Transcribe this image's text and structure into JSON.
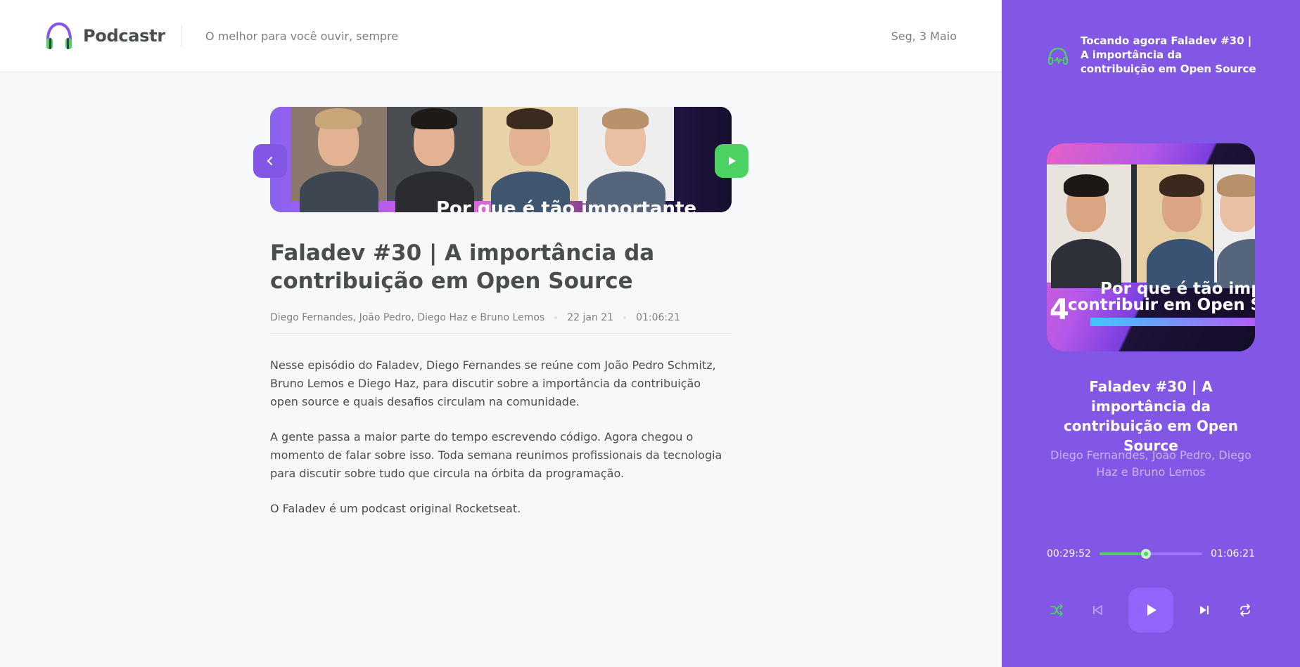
{
  "header": {
    "app_name": "Podcastr",
    "tagline": "O melhor para você ouvir, sempre",
    "date": "Seg, 3 Maio"
  },
  "episode": {
    "thumbnail_caption": "Por que é tão importante",
    "title": "Faladev #30 | A importância da contribuição em Open Source",
    "members": "Diego Fernandes, João Pedro, Diego Haz e Bruno Lemos",
    "published_at": "22 jan 21",
    "duration": "01:06:21",
    "description": [
      "Nesse episódio do Faladev, Diego Fernandes se reúne com João Pedro Schmitz, Bruno Lemos e Diego Haz, para discutir sobre a importância da contribuição open source e quais desafios circulam na comunidade.",
      "A gente passa a maior parte do tempo escrevendo código. Agora chegou o momento de falar sobre isso. Toda semana reunimos profissionais da tecnologia para discutir sobre tudo que circula na órbita da programação.",
      "O Faladev é um podcast original Rocketseat."
    ]
  },
  "player": {
    "now_playing": "Tocando agora Faladev #30 | A importância da contribuição em Open Source",
    "cover_caption_line1": "Por que é tão imp",
    "cover_caption_line2": "contribuir em Open S",
    "cover_number": "4",
    "title": "Faladev #30 | A importância da contribuição em Open Source",
    "members": "Diego Fernandes, João Pedro, Diego Haz e Bruno Lemos",
    "current_time": "00:29:52",
    "total_time": "01:06:21",
    "progress_fraction": 0.45
  },
  "icons": {
    "logo": "headphones-icon",
    "back": "chevron-left-icon",
    "play": "play-icon",
    "now_playing": "playing-headphones-icon",
    "shuffle": "shuffle-icon",
    "previous": "skip-previous-icon",
    "next": "skip-next-icon",
    "repeat": "repeat-icon"
  },
  "colors": {
    "brand_purple": "#8257e5",
    "accent_green": "#4cd263",
    "text_dark": "#494d4b",
    "text_muted": "#808080"
  }
}
